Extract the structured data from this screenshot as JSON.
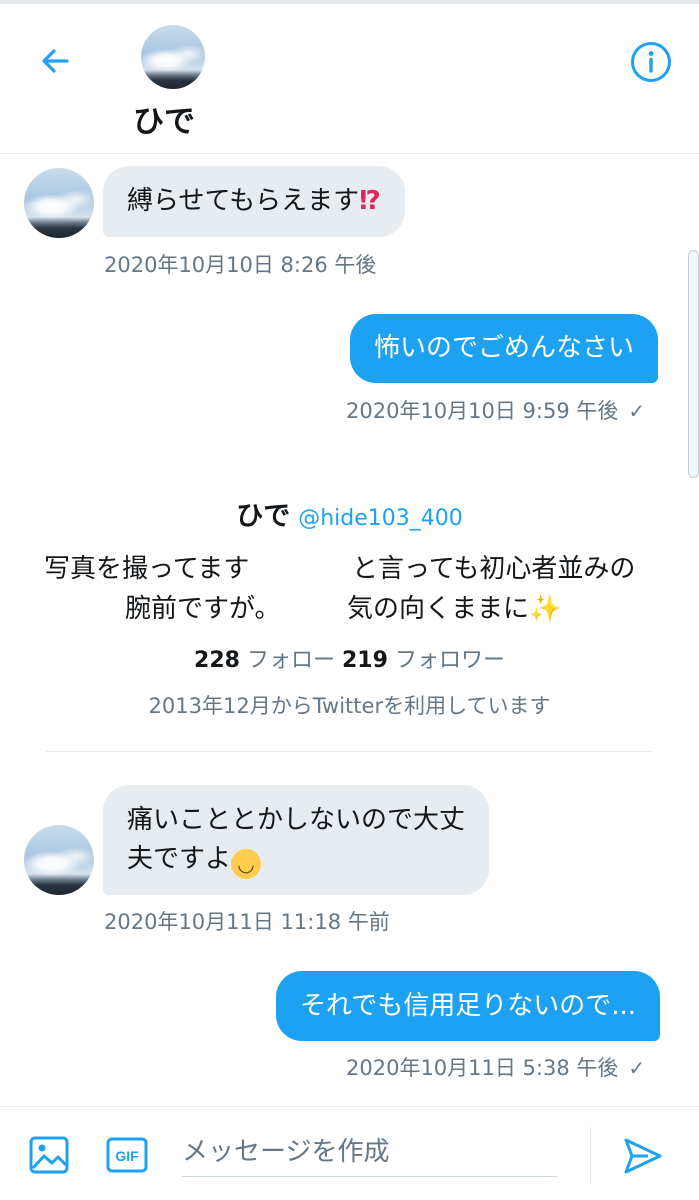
{
  "header": {
    "name": "ひで",
    "back_icon": "arrow-left-icon",
    "info_icon": "info-icon"
  },
  "messages": [
    {
      "direction": "in",
      "text": "縛らせてもらえます",
      "emoji": "⁉",
      "timestamp": "2020年10月10日 8:26 午後"
    },
    {
      "direction": "out",
      "text": "怖いのでごめんなさい",
      "timestamp": "2020年10月10日 9:59 午後",
      "status": "✓"
    },
    {
      "direction": "in",
      "text_line1": "痛いこととかしないので大丈",
      "text_line2": "夫ですよ",
      "emoji": "😅",
      "timestamp": "2020年10月11日 11:18 午前"
    },
    {
      "direction": "out",
      "text": "それでも信用足りないので...",
      "timestamp": "2020年10月11日 5:38 午後",
      "status": "✓"
    }
  ],
  "profile": {
    "name": "ひで",
    "handle": "@hide103_400",
    "bio_left_1": "写真を撮ってます",
    "bio_right_1": "と言っても初心者並みの",
    "bio_left_2": "腕前ですが。",
    "bio_right_2": "気の向くままに",
    "bio_emoji": "✨",
    "following_count": "228",
    "following_label": "フォロー",
    "followers_count": "219",
    "followers_label": "フォロワー",
    "joined": "2013年12月からTwitterを利用しています"
  },
  "composer": {
    "placeholder": "メッセージを作成",
    "media_icon": "image-icon",
    "gif_label": "GIF",
    "send_icon": "send-icon"
  },
  "colors": {
    "accent": "#1da1f2",
    "incoming_bubble": "#e6ecf0",
    "secondary_text": "#657786"
  }
}
